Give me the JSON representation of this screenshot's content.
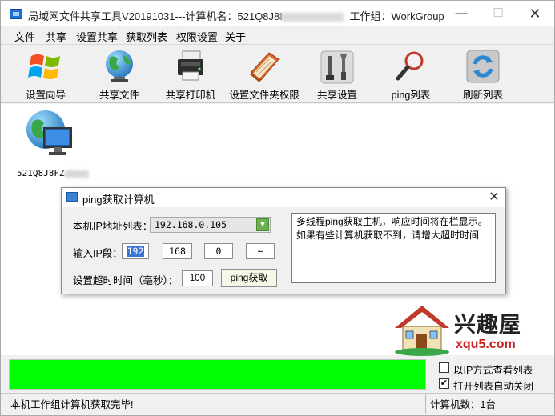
{
  "window": {
    "title_prefix": "局域网文件共享工具V20191031---计算机名：521Q8J8I",
    "title_suffix": "工作组：WorkGroup",
    "min_glyph": "—",
    "max_glyph": "☐",
    "close_glyph": "✕"
  },
  "menu": [
    "文件",
    "共享",
    "设置共享",
    "获取列表",
    "权限设置",
    "关于"
  ],
  "toolbar": [
    {
      "label": "设置向导",
      "icon": "windows-logo-icon"
    },
    {
      "label": "共享文件",
      "icon": "globe-icon"
    },
    {
      "label": "共享打印机",
      "icon": "printer-icon"
    },
    {
      "label": "设置文件夹权限",
      "icon": "folder-book-icon"
    },
    {
      "label": "共享设置",
      "icon": "tools-icon"
    },
    {
      "label": "ping列表",
      "icon": "magnifier-icon"
    },
    {
      "label": "刷新列表",
      "icon": "refresh-icon"
    }
  ],
  "computers": [
    {
      "name": "521Q8J8FZ",
      "icon": "network-computer-icon"
    }
  ],
  "dialog": {
    "title": "ping获取计算机",
    "close_glyph": "✕",
    "ip_list_label": "本机IP地址列表：",
    "ip_list_value": "192.168.0.105",
    "ip_segment_label": "输入IP段：",
    "ip_segments": [
      "192",
      "168",
      "0",
      "~"
    ],
    "timeout_label": "设置超时时间（毫秒）：",
    "timeout_value": "100",
    "ping_button": "ping获取",
    "info_text": "多线程ping获取主机，响应时间将在栏显示。如果有些计算机获取不到，请增大超时时间"
  },
  "logo": {
    "text": "兴趣屋",
    "url": "xqu5.com"
  },
  "progress": {
    "value": 1.0,
    "color": "#00ff00"
  },
  "options": [
    {
      "label": "以IP方式查看列表",
      "checked": false
    },
    {
      "label": "打开列表自动关闭",
      "checked": true
    }
  ],
  "status": {
    "left": "本机工作组计算机获取完毕!",
    "right": "计算机数：1台"
  }
}
